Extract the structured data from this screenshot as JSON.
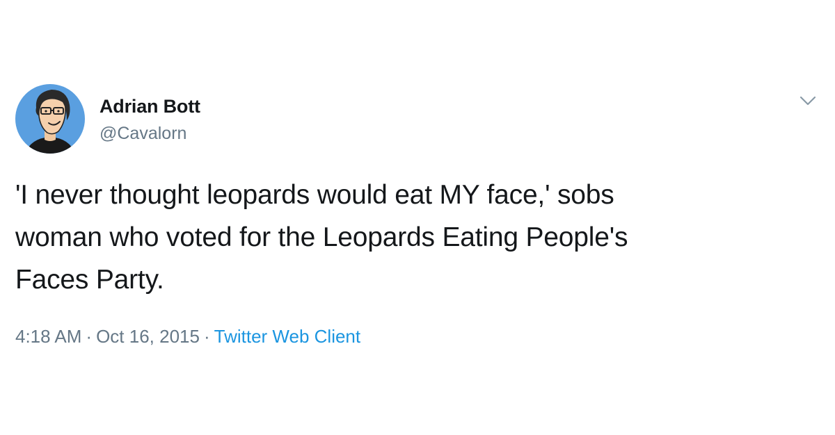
{
  "user": {
    "display_name": "Adrian Bott",
    "handle": "@Cavalorn",
    "avatar_icon": "cartoon-portrait-avatar"
  },
  "tweet": {
    "text": "'I never thought leopards would eat MY face,' sobs\nwoman who voted for the Leopards Eating People's\nFaces Party."
  },
  "meta": {
    "time": "4:18 AM",
    "separator": "·",
    "date": "Oct 16, 2015",
    "source": "Twitter Web Client"
  },
  "menu_icon": "chevron-down-icon",
  "colors": {
    "text_primary": "#14171a",
    "text_secondary": "#657786",
    "link": "#1b95e0",
    "avatar_bg": "#5a9fe0"
  }
}
